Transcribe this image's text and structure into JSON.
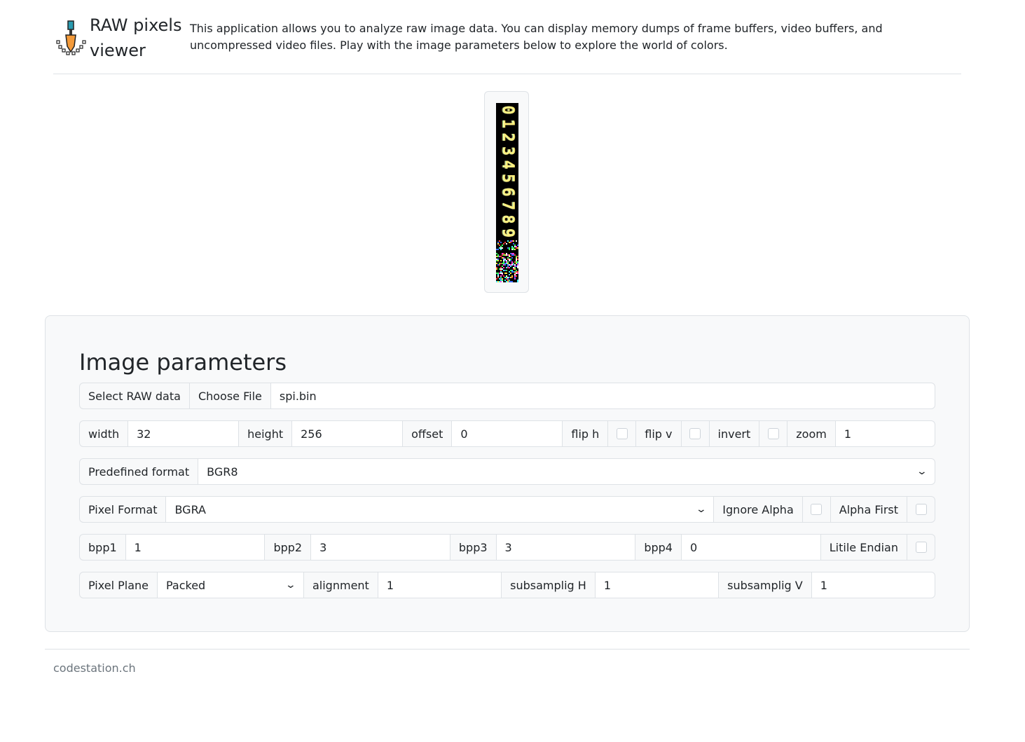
{
  "header": {
    "title": "RAW pixels viewer",
    "description": "This application allows you to analyze raw image data. You can display memory dumps of frame buffers, video buffers, and uncompressed video files. Play with the image parameters below to explore the world of colors."
  },
  "preview": {
    "digits": [
      "0",
      "1",
      "2",
      "3",
      "4",
      "5",
      "6",
      "7",
      "8",
      "9"
    ]
  },
  "params": {
    "title": "Image parameters",
    "file": {
      "label": "Select RAW data",
      "button": "Choose File",
      "filename": "spi.bin"
    },
    "geometry": {
      "width_label": "width",
      "width": "32",
      "height_label": "height",
      "height": "256",
      "offset_label": "offset",
      "offset": "0",
      "flip_h_label": "flip h",
      "flip_v_label": "flip v",
      "invert_label": "invert",
      "zoom_label": "zoom",
      "zoom": "1"
    },
    "predefined": {
      "label": "Predefined format",
      "value": "BGR8"
    },
    "pixel": {
      "format_label": "Pixel Format",
      "format": "BGRA",
      "ignore_alpha_label": "Ignore Alpha",
      "alpha_first_label": "Alpha First"
    },
    "bpp": {
      "bpp1_label": "bpp1",
      "bpp1": "1",
      "bpp2_label": "bpp2",
      "bpp2": "3",
      "bpp3_label": "bpp3",
      "bpp3": "3",
      "bpp4_label": "bpp4",
      "bpp4": "0",
      "little_endian_label": "Litile Endian"
    },
    "plane": {
      "label": "Pixel Plane",
      "value": "Packed",
      "alignment_label": "alignment",
      "alignment": "1",
      "sub_h_label": "subsamplig H",
      "sub_h": "1",
      "sub_v_label": "subsamplig V",
      "sub_v": "1"
    }
  },
  "footer": {
    "text": "codestation.ch"
  }
}
